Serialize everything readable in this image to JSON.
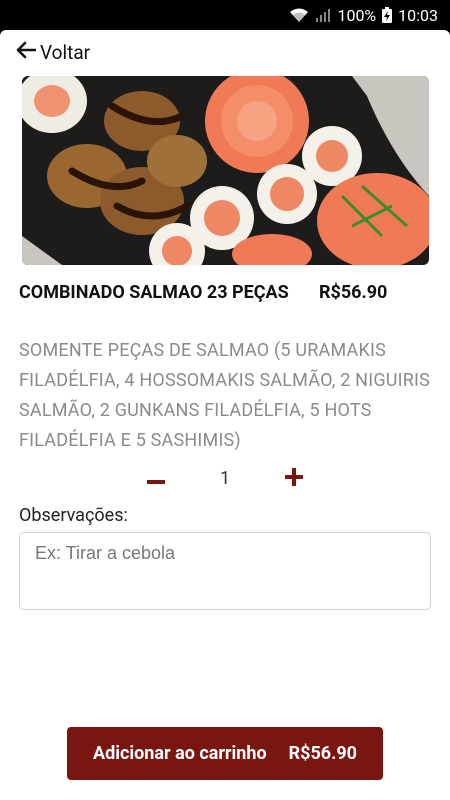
{
  "status_bar": {
    "battery": "100%",
    "time": "10:03"
  },
  "header": {
    "back_label": "Voltar"
  },
  "product": {
    "name": "COMBINADO SALMAO 23 PEÇAS",
    "price": "R$56.90",
    "description": "SOMENTE PEÇAS DE SALMAO (5 URAMAKIS FILADÉLFIA, 4 HOSSOMAKIS SALMÃO, 2 NIGUIRIS SALMÃO, 2 GUNKANS FILADÉLFIA, 5 HOTS FILADÉLFIA E 5 SASHIMIS)"
  },
  "quantity": {
    "value": "1"
  },
  "notes": {
    "label": "Observações:",
    "placeholder": "Ex: Tirar a cebola",
    "value": ""
  },
  "cart_button": {
    "label": "Adicionar ao carrinho",
    "price": "R$56.90"
  },
  "colors": {
    "accent": "#7a1612",
    "description": "#8a8a8a"
  }
}
